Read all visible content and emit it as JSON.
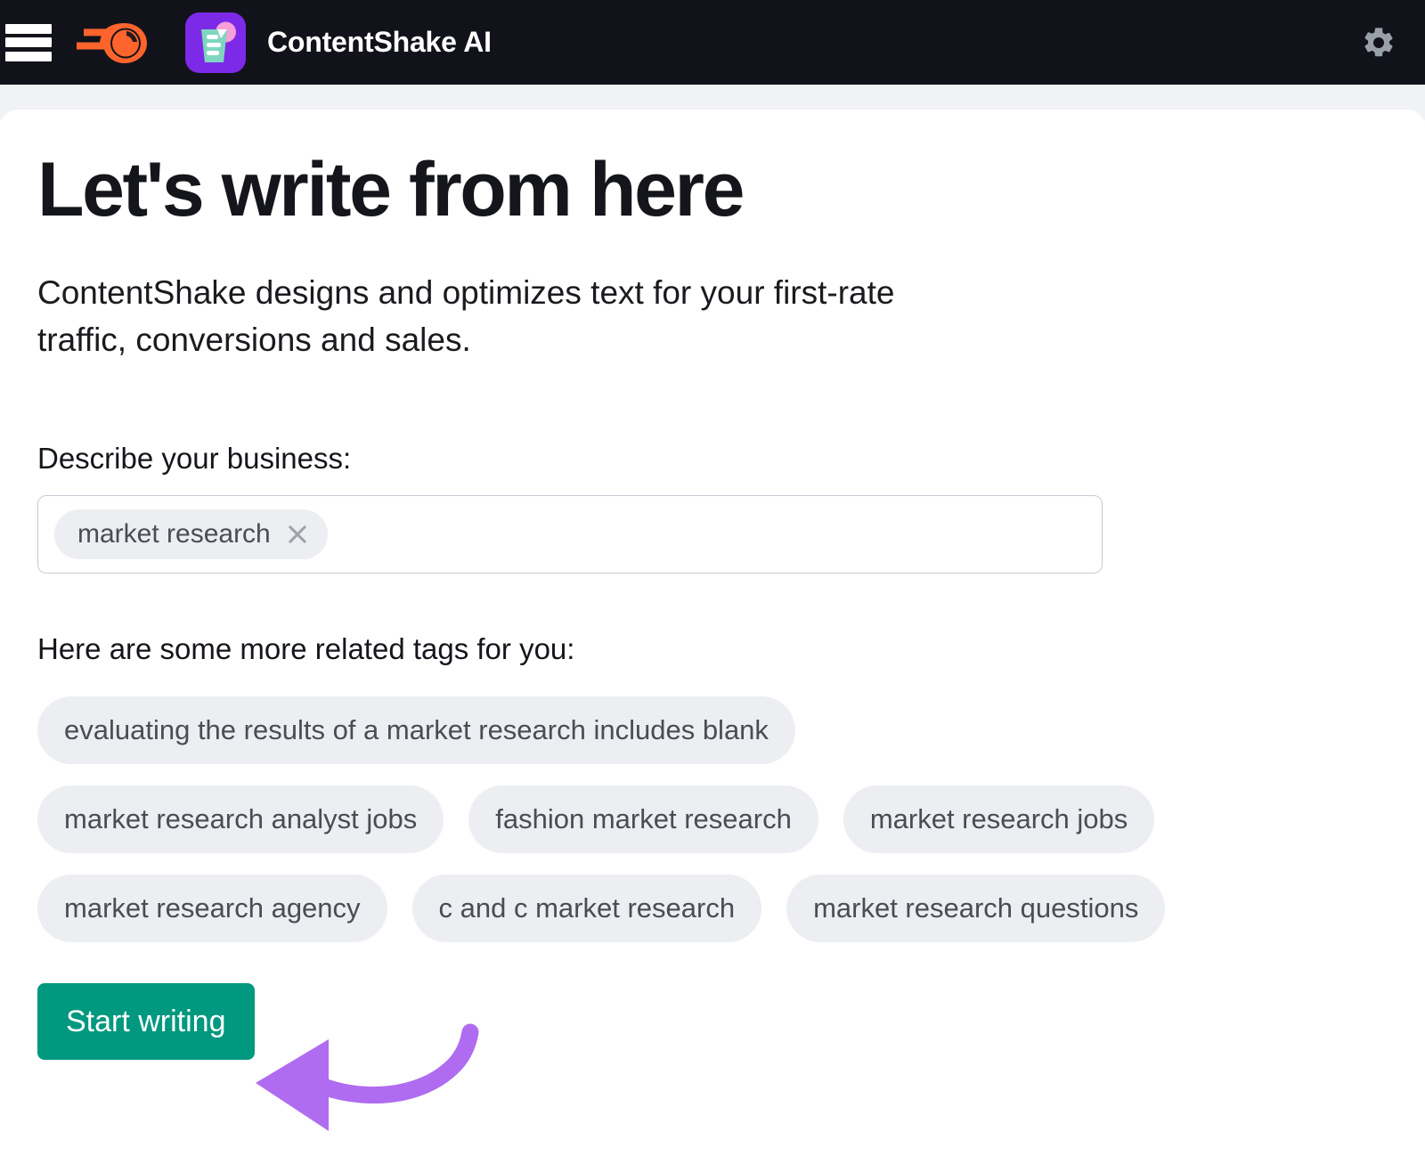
{
  "topbar": {
    "menu_icon": "hamburger-menu-icon",
    "brand_logo_icon": "semrush-logo-icon",
    "app_icon": "contentshake-app-icon",
    "app_title": "ContentShake AI",
    "settings_icon": "gear-icon",
    "background_color": "#12131a"
  },
  "main": {
    "headline": "Let's write from here",
    "subhead": "ContentShake designs and optimizes text for your first-rate traffic, conversions and sales.",
    "business_field": {
      "label": "Describe your business:",
      "placeholder": "",
      "chips": [
        {
          "text": "market research",
          "close_icon": "close-x-icon"
        }
      ]
    },
    "related": {
      "label": "Here are some more related tags for you:",
      "rows": [
        [
          "evaluating the results of a market research includes blank"
        ],
        [
          "market research analyst jobs",
          "fashion market research",
          "market research jobs"
        ],
        [
          "market research agency",
          "c and c market research",
          "market research questions"
        ]
      ]
    },
    "start_button": {
      "label": "Start writing",
      "color": "#00987f",
      "text_color": "#ffffff"
    }
  },
  "annotation": {
    "arrow_color": "#b06cf0",
    "points_to": "Start writing"
  },
  "colors": {
    "chip_bg": "#eceef2",
    "chip_text": "#4b4c55",
    "headline": "#15161c",
    "page_strip": "#f1f2f6",
    "app_icon_bg": "#7c2ae8",
    "semrush_orange": "#ff642d"
  }
}
